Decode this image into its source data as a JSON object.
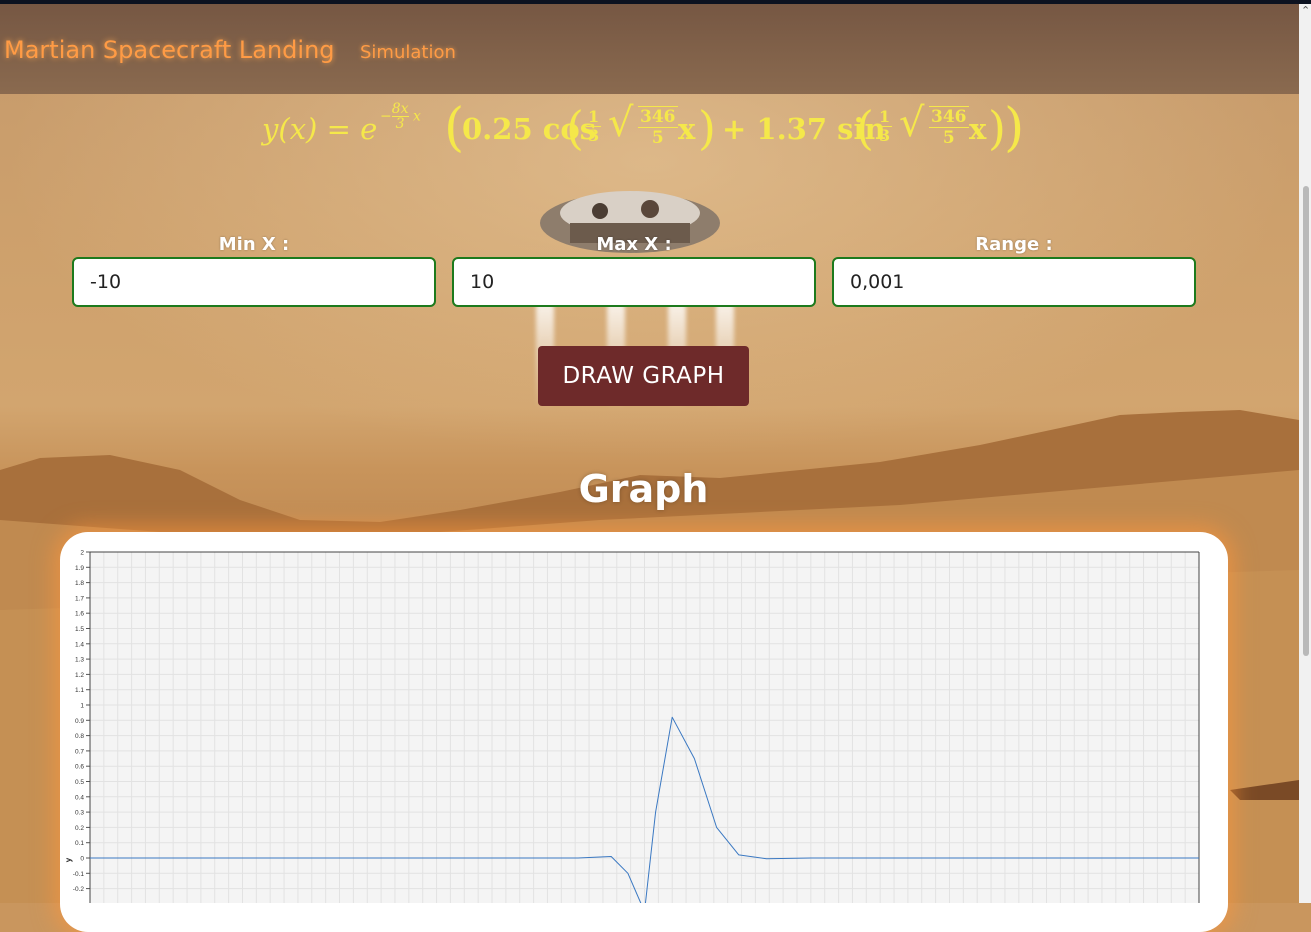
{
  "navbar": {
    "brand": "Martian Spacecraft Landing",
    "link": "Simulation"
  },
  "equation": {
    "lhs": "y(x) = e",
    "exponent": "−8x/3 x",
    "body": "(0.25 cos(1/3 √(346/5) x) + 1.37 sin(1/3 √(346/5) x))",
    "coeff_cos": "0.25",
    "coeff_sin": "1.37"
  },
  "form": {
    "min_x": {
      "label": "Min X :",
      "value": "-10"
    },
    "max_x": {
      "label": "Max X :",
      "value": "10"
    },
    "range": {
      "label": "Range :",
      "value": "0,001"
    },
    "draw_button": "DRAW GRAPH"
  },
  "graph": {
    "heading": "Graph"
  },
  "colors": {
    "accent_orange": "#ff9b45",
    "equation_yellow": "#f5e84a",
    "field_border": "#1d7a1d",
    "button_bg": "#6e2a2a",
    "line": "#3a78c2"
  },
  "chart_data": {
    "type": "line",
    "ylabel": "y",
    "ylim": [
      -0.2,
      2
    ],
    "xlim": [
      -10,
      10
    ],
    "y_ticks": [
      "2",
      "1.9",
      "1.8",
      "1.7",
      "1.6",
      "1.5",
      "1.4",
      "1.3",
      "1.2",
      "1.1",
      "1",
      "0.9",
      "0.8",
      "0.7",
      "0.6",
      "0.5",
      "0.4",
      "0.3",
      "0.2",
      "0.1",
      "0",
      "-0.1",
      "-0.2"
    ],
    "grid": true,
    "series": [
      {
        "x": [
          -10,
          -2,
          -1.2,
          -0.6,
          -0.3,
          0,
          0.2,
          0.5,
          0.9,
          1.3,
          1.7,
          2.2,
          3,
          10
        ],
        "y": [
          0,
          0,
          0,
          0.01,
          -0.1,
          -0.35,
          0.3,
          0.92,
          0.65,
          0.2,
          0.02,
          -0.005,
          0,
          0
        ]
      }
    ]
  }
}
